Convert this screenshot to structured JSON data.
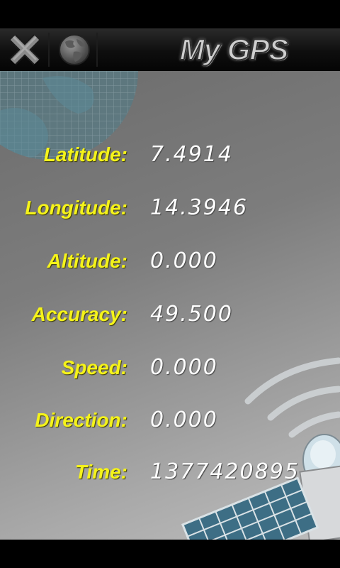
{
  "toolbar": {
    "title": "My GPS",
    "close_icon": "close-x-icon",
    "globe_icon": "globe-icon"
  },
  "fields": [
    {
      "label": "Latitude:",
      "value": "7.4914"
    },
    {
      "label": "Longitude:",
      "value": "14.3946"
    },
    {
      "label": "Altitude:",
      "value": "0.000"
    },
    {
      "label": "Accuracy:",
      "value": "49.500"
    },
    {
      "label": "Speed:",
      "value": "0.000"
    },
    {
      "label": "Direction:",
      "value": "0.000"
    },
    {
      "label": "Time:",
      "value": "1377420895"
    }
  ],
  "colors": {
    "label": "#f5f31a",
    "value": "#ffffff",
    "toolbar": "#111111"
  }
}
